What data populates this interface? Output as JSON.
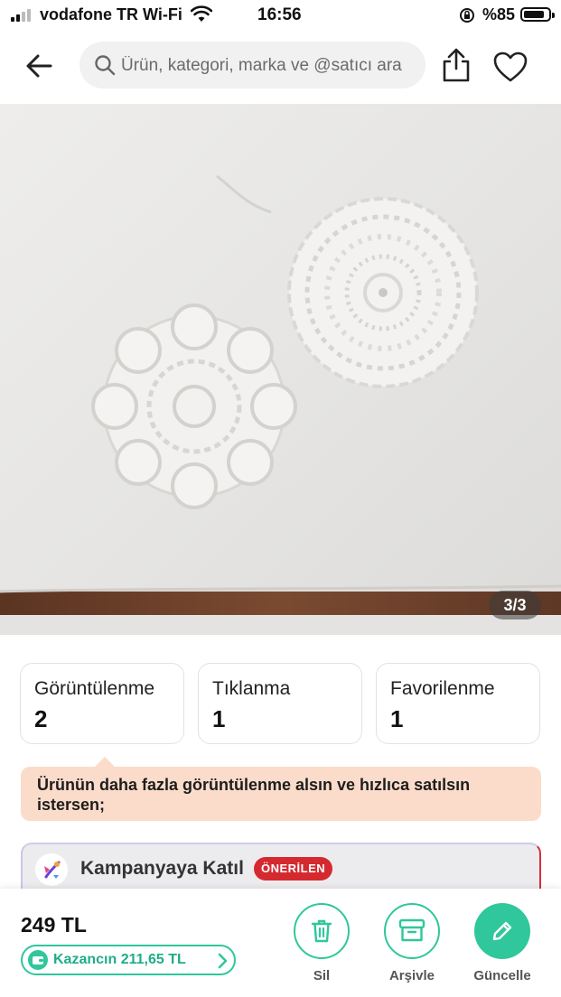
{
  "status_bar": {
    "carrier": "vodafone TR Wi-Fi",
    "time": "16:56",
    "battery": "%85",
    "battery_level": 0.85
  },
  "header": {
    "search_placeholder": "Ürün, kategori, marka ve @satıcı ara"
  },
  "gallery": {
    "pager": "3/3"
  },
  "stats": [
    {
      "label": "Görüntülenme",
      "value": "2"
    },
    {
      "label": "Tıklanma",
      "value": "1"
    },
    {
      "label": "Favorilenme",
      "value": "1"
    }
  ],
  "promo": {
    "text": "Ürünün daha fazla görüntülenme alsın ve hızlıca satılsın istersen;"
  },
  "campaign": {
    "title": "Kampanyaya Katıl",
    "badge": "ÖNERİLEN"
  },
  "bottom_bar": {
    "price": "249 TL",
    "earnings": "Kazancın 211,65 TL",
    "actions": [
      {
        "label": "Sil",
        "icon": "trash-icon",
        "color": "#2fc79b"
      },
      {
        "label": "Arşivle",
        "icon": "archive-icon",
        "color": "#2fc79b"
      },
      {
        "label": "Güncelle",
        "icon": "pencil-icon",
        "color": "#2fc79b"
      }
    ]
  },
  "colors": {
    "accent_green": "#2fc79b",
    "promo_bg": "#fbdccb",
    "badge_red": "#d42a2f"
  }
}
